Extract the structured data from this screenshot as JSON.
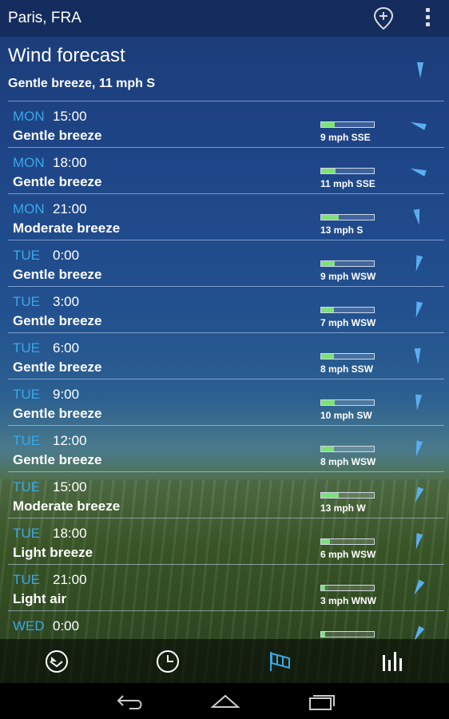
{
  "topbar": {
    "city": "Paris, FRA",
    "add_location_icon": "map-pin-plus-icon",
    "menu_icon": "overflow-menu-icon"
  },
  "header": {
    "title": "Wind forecast",
    "current": "Gentle breeze, 11 mph S"
  },
  "forecast": [
    {
      "day": "MON",
      "time": "15:00",
      "desc": "Gentle breeze",
      "speed": "9 mph SSE",
      "level": 0.25,
      "dir": "SSE"
    },
    {
      "day": "MON",
      "time": "18:00",
      "desc": "Gentle breeze",
      "speed": "11 mph SSE",
      "level": 0.28,
      "dir": "SSE"
    },
    {
      "day": "MON",
      "time": "21:00",
      "desc": "Moderate breeze",
      "speed": "13 mph S",
      "level": 0.33,
      "dir": "S"
    },
    {
      "day": "TUE",
      "time": "0:00",
      "desc": "Gentle breeze",
      "speed": "9 mph WSW",
      "level": 0.25,
      "dir": "WSW"
    },
    {
      "day": "TUE",
      "time": "3:00",
      "desc": "Gentle breeze",
      "speed": "7 mph WSW",
      "level": 0.24,
      "dir": "WSW"
    },
    {
      "day": "TUE",
      "time": "6:00",
      "desc": "Gentle breeze",
      "speed": "8 mph SSW",
      "level": 0.24,
      "dir": "SSW"
    },
    {
      "day": "TUE",
      "time": "9:00",
      "desc": "Gentle breeze",
      "speed": "10 mph SW",
      "level": 0.25,
      "dir": "SW"
    },
    {
      "day": "TUE",
      "time": "12:00",
      "desc": "Gentle breeze",
      "speed": "8 mph WSW",
      "level": 0.24,
      "dir": "WSW"
    },
    {
      "day": "TUE",
      "time": "15:00",
      "desc": "Moderate breeze",
      "speed": "13 mph W",
      "level": 0.33,
      "dir": "W"
    },
    {
      "day": "TUE",
      "time": "18:00",
      "desc": "Light breeze",
      "speed": "6 mph WSW",
      "level": 0.16,
      "dir": "WSW"
    },
    {
      "day": "TUE",
      "time": "21:00",
      "desc": "Light air",
      "speed": "3 mph WNW",
      "level": 0.08,
      "dir": "WNW"
    },
    {
      "day": "WED",
      "time": "0:00",
      "desc": "",
      "speed": "",
      "level": 0.08,
      "dir": "WNW"
    }
  ],
  "bottom_nav": {
    "items": [
      {
        "icon": "today-pie-icon",
        "active": false
      },
      {
        "icon": "hourly-clock-icon",
        "active": false
      },
      {
        "icon": "wind-flag-icon",
        "active": true
      },
      {
        "icon": "daily-bars-icon",
        "active": false
      }
    ]
  },
  "system_nav": {
    "back": "back-icon",
    "home": "home-icon",
    "recents": "recents-icon"
  },
  "colors": {
    "day_label": "#3aa7e8",
    "bar_fill": "#7ee07a",
    "arrow": "#5aaef0",
    "active_tab": "#3aa7e8"
  }
}
